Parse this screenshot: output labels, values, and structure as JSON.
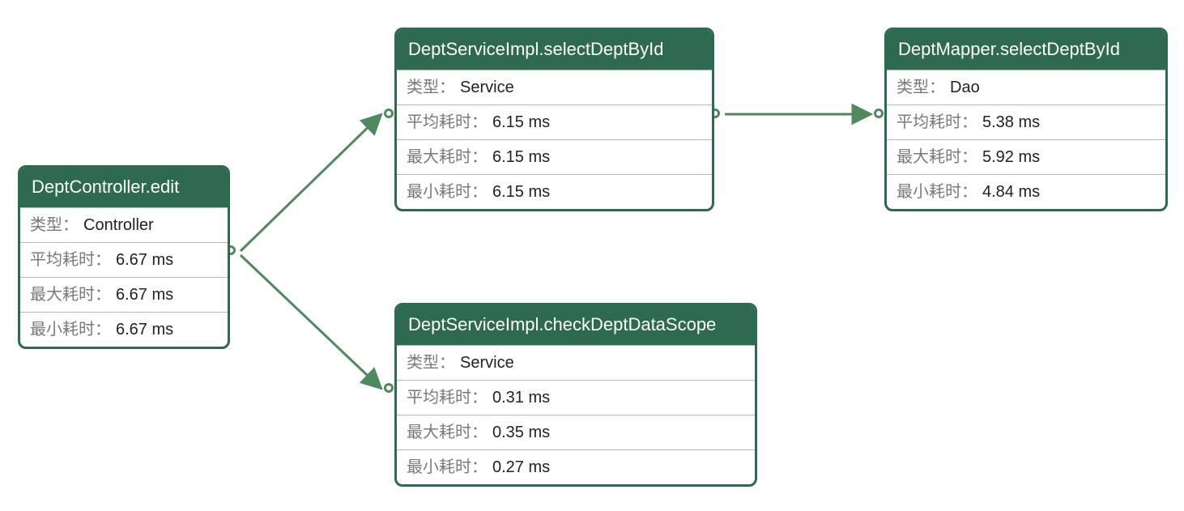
{
  "labels": {
    "type": "类型：",
    "avg": "平均耗时：",
    "max": "最大耗时：",
    "min": "最小耗时："
  },
  "nodes": {
    "controller": {
      "title": "DeptController.edit",
      "type": "Controller",
      "avg": "6.67 ms",
      "max": "6.67 ms",
      "min": "6.67 ms"
    },
    "svcSelect": {
      "title": "DeptServiceImpl.selectDeptById",
      "type": "Service",
      "avg": "6.15 ms",
      "max": "6.15 ms",
      "min": "6.15 ms"
    },
    "mapper": {
      "title": "DeptMapper.selectDeptById",
      "type": "Dao",
      "avg": "5.38 ms",
      "max": "5.92 ms",
      "min": "4.84 ms"
    },
    "svcScope": {
      "title": "DeptServiceImpl.checkDeptDataScope",
      "type": "Service",
      "avg": "0.31 ms",
      "max": "0.35 ms",
      "min": "0.27 ms"
    }
  },
  "edges": [
    {
      "from": "controller",
      "to": "svcSelect"
    },
    {
      "from": "controller",
      "to": "svcScope"
    },
    {
      "from": "svcSelect",
      "to": "mapper"
    }
  ]
}
